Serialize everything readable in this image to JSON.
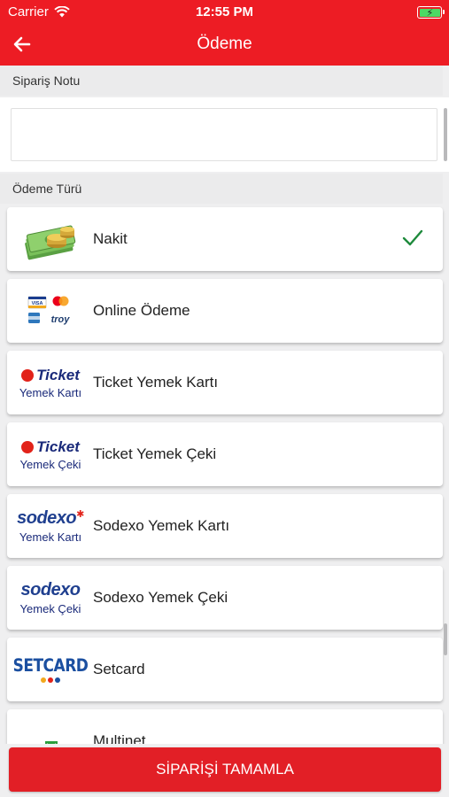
{
  "status_bar": {
    "carrier": "Carrier",
    "time": "12:55 PM"
  },
  "navbar": {
    "title": "Ödeme",
    "back_icon": "back-arrow-icon"
  },
  "order_note": {
    "section_title": "Sipariş Notu",
    "value": "",
    "placeholder": ""
  },
  "payment": {
    "section_title": "Ödeme Türü",
    "selected": "Nakit",
    "options": [
      {
        "label": "Nakit",
        "icon": "cash-icon",
        "selected": true
      },
      {
        "label": "Online Ödeme",
        "icon": "card-brands-icon",
        "logo_text": [
          "VISA",
          "troy"
        ]
      },
      {
        "label": "Ticket Yemek Kartı",
        "icon": "ticket-logo",
        "logo_text": [
          "Ticket",
          "Yemek Kartı"
        ]
      },
      {
        "label": "Ticket Yemek Çeki",
        "icon": "ticket-logo",
        "logo_text": [
          "Ticket",
          "Yemek Çeki"
        ]
      },
      {
        "label": "Sodexo Yemek Kartı",
        "icon": "sodexo-logo",
        "logo_text": [
          "sodexo",
          "Yemek Kartı"
        ]
      },
      {
        "label": "Sodexo Yemek Çeki",
        "icon": "sodexo-logo",
        "logo_text": [
          "sodexo",
          "Yemek Çeki"
        ]
      },
      {
        "label": "Setcard",
        "icon": "setcard-logo",
        "logo_text": [
          "SETCARD"
        ]
      },
      {
        "label": "Multinet",
        "icon": "multinet-logo"
      }
    ]
  },
  "submit": {
    "label": "SİPARİŞİ TAMAMLA"
  },
  "colors": {
    "brand_red": "#ed1c24",
    "check_green": "#1e8a3c"
  }
}
